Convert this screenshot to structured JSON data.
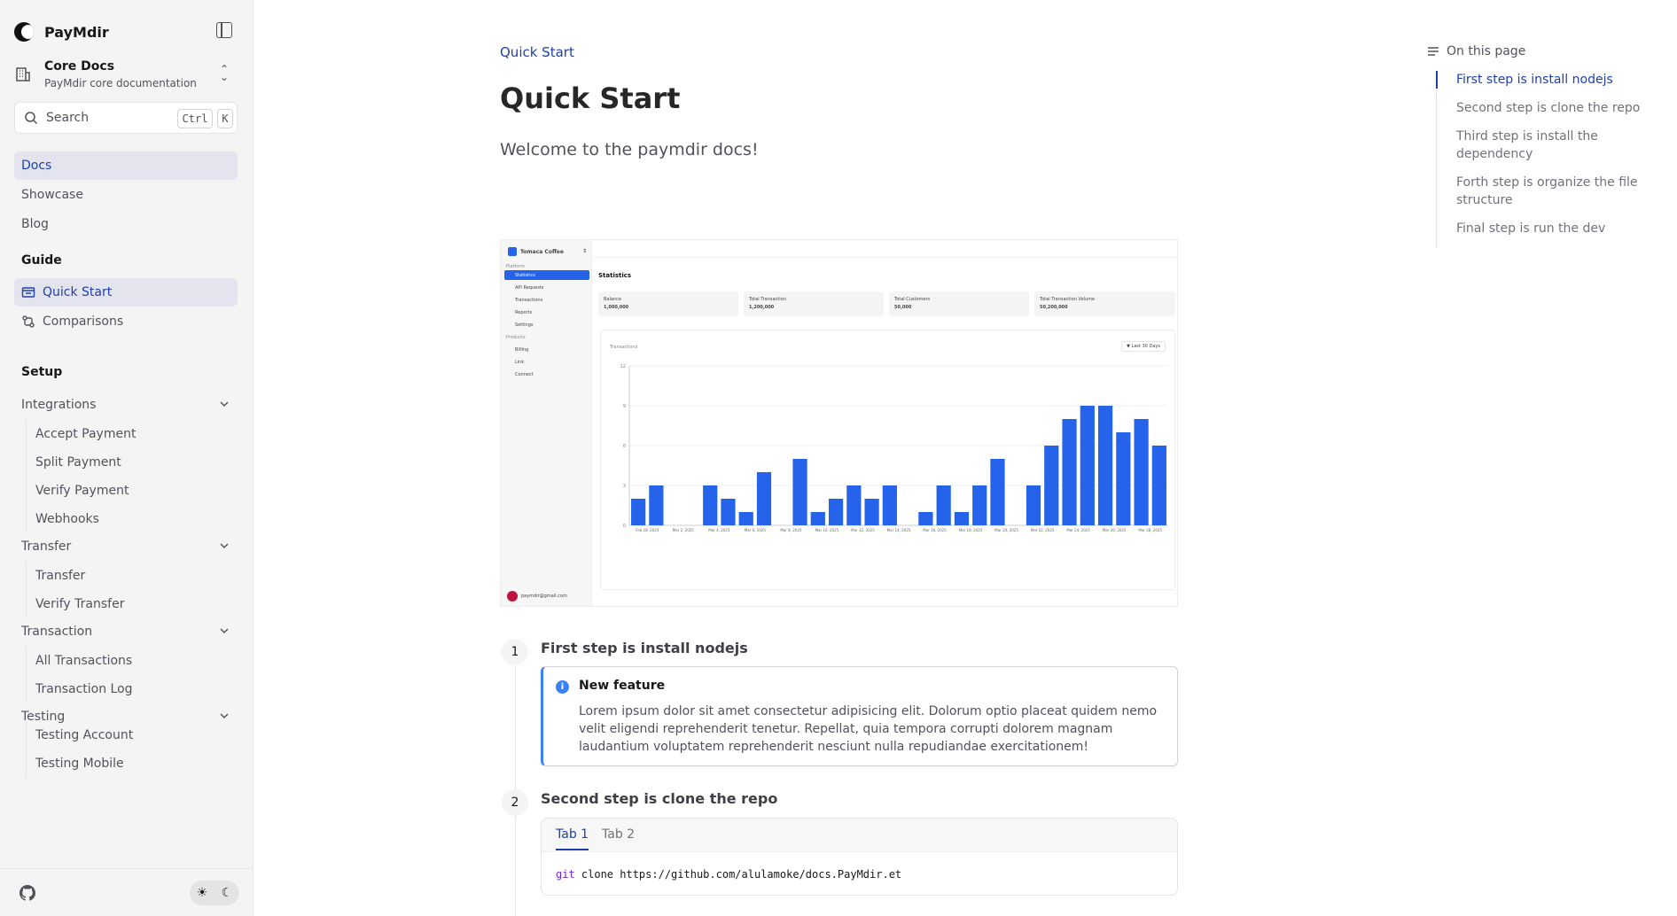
{
  "sidebar": {
    "brand": "PayMdir",
    "project": {
      "title": "Core Docs",
      "subtitle": "PayMdir core documentation"
    },
    "search": {
      "placeholder": "Search",
      "shortcut_ctrl": "Ctrl",
      "shortcut_key": "K"
    },
    "top_nav": [
      "Docs",
      "Showcase",
      "Blog"
    ],
    "guide": {
      "title": "Guide",
      "items": [
        "Quick Start",
        "Comparisons"
      ]
    },
    "setup": {
      "title": "Setup",
      "groups": [
        {
          "label": "Integrations",
          "items": [
            "Accept Payment",
            "Split Payment",
            "Verify Payment",
            "Webhooks"
          ]
        },
        {
          "label": "Transfer",
          "items": [
            "Transfer",
            "Verify Transfer"
          ]
        },
        {
          "label": "Transaction",
          "items": [
            "All Transactions",
            "Transaction Log"
          ]
        },
        {
          "label": "Testing",
          "items": [
            "Testing Account",
            "Testing Mobile"
          ]
        }
      ]
    }
  },
  "main": {
    "breadcrumb": "Quick Start",
    "title": "Quick Start",
    "lead": "Welcome to the paymdir docs!",
    "steps": [
      {
        "number": "1",
        "title": "First step is install nodejs"
      },
      {
        "number": "2",
        "title": "Second step is clone the repo"
      }
    ],
    "callout": {
      "title": "New feature",
      "body": "Lorem ipsum dolor sit amet consectetur adipisicing elit. Dolorum optio placeat quidem nemo velit eligendi reprehenderit tenetur. Repellat, quia tempora corrupti dolorem magnam laudantium voluptatem reprehenderit nesciunt nulla repudiandae exercitationem!"
    },
    "tabs": [
      "Tab 1",
      "Tab 2"
    ],
    "code": {
      "cmd": "git",
      "rest": " clone https://github.com/alulamoke/docs.PayMdir.et"
    }
  },
  "toc": {
    "title": "On this page",
    "items": [
      "First step is install nodejs",
      "Second step is clone the repo",
      "Third step is install the dependency",
      "Forth step is organize the file structure",
      "Final step is run the dev"
    ]
  },
  "screenshot": {
    "company": "Tomaca Coffee",
    "section_platform": "Platform",
    "nav": [
      "Statistics",
      "API Requests",
      "Transactions",
      "Reports",
      "Settings"
    ],
    "section_products": "Products",
    "products": [
      "Billing",
      "Link",
      "Connect"
    ],
    "user_email": "paymdir@gmail.com",
    "page_title": "Statistics",
    "stats": [
      {
        "label": "Balance",
        "value": "1,000,000",
        "icon": "$"
      },
      {
        "label": "Total Transaction",
        "value": "1,200,000",
        "icon": "tag"
      },
      {
        "label": "Total Customers",
        "value": "50,000",
        "icon": "user"
      },
      {
        "label": "Total Transaction Volume",
        "value": "50,200,000",
        "icon": "$"
      }
    ],
    "chart_title": "Transactions",
    "filter": "Last 30 Days"
  },
  "chart_data": {
    "type": "bar",
    "title": "Transactions",
    "ylim": [
      0,
      12
    ],
    "yticks": [
      "0",
      "3",
      "6",
      "9",
      "12"
    ],
    "tick_labels": [
      "Feb 28, 2025",
      "Mar 2, 2025",
      "Mar 4, 2025",
      "Mar 6, 2025",
      "Mar 8, 2025",
      "Mar 10, 2025",
      "Mar 12, 2025",
      "Mar 14, 2025",
      "Mar 16, 2025",
      "Mar 18, 2025",
      "Mar 20, 2025",
      "Mar 22, 2025",
      "Mar 24, 2025",
      "Mar 26, 2025",
      "Mar 28, 2025"
    ],
    "values": [
      2,
      3,
      0,
      0,
      3,
      2,
      1,
      4,
      0,
      5,
      1,
      2,
      3,
      2,
      3,
      0,
      1,
      3,
      1,
      3,
      5,
      0,
      3,
      6,
      8,
      9,
      9,
      7,
      8,
      6
    ],
    "color": "#2563eb",
    "grid": true
  }
}
